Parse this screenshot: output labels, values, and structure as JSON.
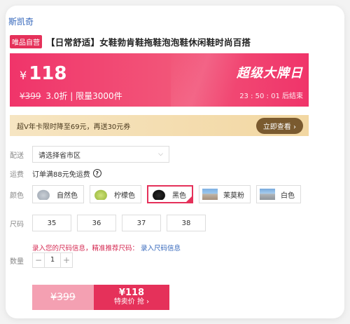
{
  "brand": "斯凯奇",
  "vip_badge": "唯品自营",
  "title": "【日常舒适】女鞋勃肯鞋拖鞋泡泡鞋休闲鞋时尚百搭",
  "price": {
    "currency": "¥",
    "current": "118",
    "original": "¥399",
    "discount": "3.0折",
    "limit": "| 限量3000件",
    "super_label": "超级大牌日",
    "countdown": "23 : 50 : 01  后结束"
  },
  "vip_offer": {
    "text": "超V年卡限时降至69元，再送30元券",
    "button": "立即查看 ›"
  },
  "delivery": {
    "label": "配送",
    "placeholder": "请选择省市区"
  },
  "shipping": {
    "label": "运费",
    "text": "订单满88元免运费"
  },
  "colors": {
    "label": "颜色",
    "options": [
      "自然色",
      "柠檬色",
      "黑色",
      "茉莫粉",
      "白色"
    ]
  },
  "sizes": {
    "label": "尺码",
    "options": [
      "35",
      "36",
      "37",
      "38"
    ],
    "hint": "录入您的尺码信息，精准推荐尺码：",
    "hint_link": "录入尺码信息"
  },
  "quantity": {
    "label": "数量",
    "value": "1",
    "minus": "−",
    "plus": "+"
  },
  "buy": {
    "old_price": "¥399",
    "new_price": "¥118",
    "action": "特卖价 抢 ›"
  },
  "colors_theme": {
    "accent": "#e5315a",
    "link": "#3366bb",
    "gold": "#7a5a2f"
  }
}
